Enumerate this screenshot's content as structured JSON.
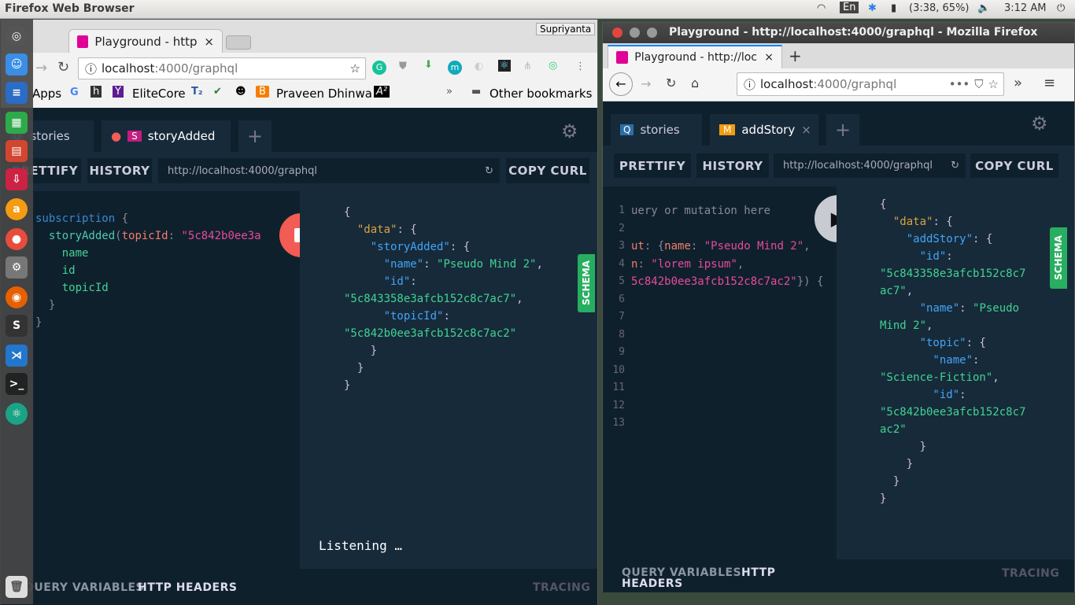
{
  "topbar": {
    "app_title": "Firefox Web Browser",
    "lang": "En",
    "battery": "(3:38, 65%)",
    "clock": "3:12 AM"
  },
  "left": {
    "user_badge": "Supriyanta",
    "tab_title": "Playground - http://",
    "address": {
      "host": "localhost",
      "rest": ":4000/graphql"
    },
    "bookmarks": [
      "Apps",
      "EliteCore",
      "Praveen Dhinwa"
    ],
    "other_bookmarks": "Other bookmarks",
    "pg_tabs": [
      {
        "badge": "Q",
        "label": "stories"
      },
      {
        "badge": "S",
        "label": "storyAdded"
      }
    ],
    "prettify": "PRETTIFY",
    "history": "HISTORY",
    "endpoint": "http://localhost:4000/graphql",
    "copy_curl": "COPY CURL",
    "query": [
      [
        [
          "subscription",
          "kw"
        ],
        [
          " {",
          "pu"
        ]
      ],
      [
        [
          "  storyAdded",
          "fn"
        ],
        [
          "(",
          "pu"
        ],
        [
          "topicId",
          "ar"
        ],
        [
          ": ",
          "pu"
        ],
        [
          "\"5c842b0ee3a",
          "st"
        ]
      ],
      [
        [
          "    name",
          "at"
        ]
      ],
      [
        [
          "    id",
          "at"
        ]
      ],
      [
        [
          "    topicId",
          "at"
        ]
      ],
      [
        [
          "  }",
          "pu"
        ]
      ],
      [
        [
          "}",
          "pu"
        ]
      ]
    ],
    "result": [
      [
        [
          "{",
          "pr"
        ]
      ],
      [
        [
          "  \"data\"",
          "jk"
        ],
        [
          ": {",
          "pr"
        ]
      ],
      [
        [
          "    \"storyAdded\"",
          "jk2"
        ],
        [
          ": {",
          "pr"
        ]
      ],
      [
        [
          "      \"name\"",
          "jk2"
        ],
        [
          ": ",
          "pr"
        ],
        [
          "\"Pseudo Mind 2\"",
          "js"
        ],
        [
          ",",
          "pr"
        ]
      ],
      [
        [
          "      \"id\"",
          "jk2"
        ],
        [
          ":",
          "pr"
        ]
      ],
      [
        [
          "\"5c843358e3afcb152c8c7ac7\"",
          "js"
        ],
        [
          ",",
          "pr"
        ]
      ],
      [
        [
          "      \"topicId\"",
          "jk2"
        ],
        [
          ":",
          "pr"
        ]
      ],
      [
        [
          "\"5c842b0ee3afcb152c8c7ac2\"",
          "js"
        ]
      ],
      [
        [
          "    }",
          "pr"
        ]
      ],
      [
        [
          "  }",
          "pr"
        ]
      ],
      [
        [
          "}",
          "pr"
        ]
      ]
    ],
    "listening": "Listening …",
    "schema": "SCHEMA",
    "query_variables": "QUERY VARIABLES",
    "http_headers": "HTTP HEADERS",
    "tracing": "TRACING"
  },
  "right": {
    "window_title": "Playground - http://localhost:4000/graphql - Mozilla Firefox",
    "tab_title": "Playground - http://loca",
    "address": {
      "host": "localhost",
      "rest": ":4000/graphql"
    },
    "pg_tabs": [
      {
        "badge": "Q",
        "label": "stories"
      },
      {
        "badge": "M",
        "label": "addStory"
      }
    ],
    "prettify": "PRETTIFY",
    "history": "HISTORY",
    "endpoint": "http://localhost:4000/graphql",
    "copy_curl": "COPY CURL",
    "line_numbers": [
      "1",
      "2",
      "3",
      "4",
      "5",
      "6",
      "7",
      "8",
      "9",
      "10",
      "11",
      "12",
      "13"
    ],
    "query": [
      [
        [
          "uery or mutation here",
          "pu"
        ]
      ],
      [
        [
          "",
          "pu"
        ]
      ],
      [
        [
          "ut",
          "ar"
        ],
        [
          ": {",
          "pu"
        ],
        [
          "name",
          "ar"
        ],
        [
          ": ",
          "pu"
        ],
        [
          "\"Pseudo Mind 2\"",
          "st"
        ],
        [
          ",",
          "pu"
        ]
      ],
      [
        [
          "n",
          "ar"
        ],
        [
          ": ",
          "pu"
        ],
        [
          "\"lorem ipsum\"",
          "st"
        ],
        [
          ",",
          "pu"
        ]
      ],
      [
        [
          "5c842b0ee3afcb152c8c7ac2\"",
          "st"
        ],
        [
          "}) {",
          "pu"
        ]
      ]
    ],
    "result": [
      [
        [
          "{",
          "pr"
        ]
      ],
      [
        [
          "  \"data\"",
          "jk"
        ],
        [
          ": {",
          "pr"
        ]
      ],
      [
        [
          "    \"addStory\"",
          "jk2"
        ],
        [
          ": {",
          "pr"
        ]
      ],
      [
        [
          "      \"id\"",
          "jk2"
        ],
        [
          ":",
          "pr"
        ]
      ],
      [
        [
          "\"5c843358e3afcb152c8c7",
          "js"
        ]
      ],
      [
        [
          "ac7\"",
          "js"
        ],
        [
          ",",
          "pr"
        ]
      ],
      [
        [
          "      \"name\"",
          "jk2"
        ],
        [
          ": ",
          "pr"
        ],
        [
          "\"Pseudo",
          "js"
        ]
      ],
      [
        [
          "Mind 2\"",
          "js"
        ],
        [
          ",",
          "pr"
        ]
      ],
      [
        [
          "      \"topic\"",
          "jk2"
        ],
        [
          ": {",
          "pr"
        ]
      ],
      [
        [
          "        \"name\"",
          "jk2"
        ],
        [
          ":",
          "pr"
        ]
      ],
      [
        [
          "\"Science-Fiction\"",
          "js"
        ],
        [
          ",",
          "pr"
        ]
      ],
      [
        [
          "        \"id\"",
          "jk2"
        ],
        [
          ":",
          "pr"
        ]
      ],
      [
        [
          "\"5c842b0ee3afcb152c8c7",
          "js"
        ]
      ],
      [
        [
          "ac2\"",
          "js"
        ]
      ],
      [
        [
          "      }",
          "pr"
        ]
      ],
      [
        [
          "    }",
          "pr"
        ]
      ],
      [
        [
          "  }",
          "pr"
        ]
      ],
      [
        [
          "}",
          "pr"
        ]
      ]
    ],
    "schema": "SCHEMA",
    "query_variables": "QUERY VARIABLES",
    "http_headers": "HTTP HEADERS",
    "tracing": "TRACING"
  }
}
